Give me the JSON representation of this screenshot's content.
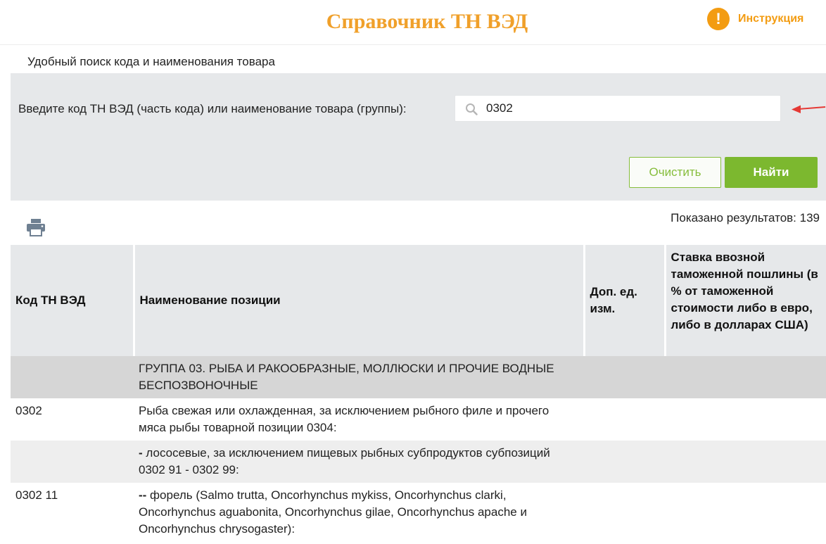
{
  "header": {
    "title": "Справочник ТН ВЭД",
    "help_label": "Инструкция",
    "help_icon_glyph": "!"
  },
  "subtitle": "Удобный поиск кода и наименования товара",
  "search": {
    "label": "Введите код ТН ВЭД (часть кода) или наименование товара (группы):",
    "value": "0302",
    "clear_label": "Очистить",
    "find_label": "Найти"
  },
  "results": {
    "count_text": "Показано результатов: 139"
  },
  "table": {
    "headers": {
      "code": "Код ТН ВЭД",
      "name": "Наименование позиции",
      "unit": "Доп. ед. изм.",
      "rate": "Ставка ввозной таможенной пошлины (в % от таможенной стоимости либо в евро, либо в долларах США)"
    },
    "rows": [
      {
        "code": "",
        "name": "ГРУППА 03. РЫБА И РАКООБРАЗНЫЕ, МОЛЛЮСКИ И ПРОЧИЕ ВОДНЫЕ БЕСПОЗВОНОЧНЫЕ",
        "unit": "",
        "rate": ""
      },
      {
        "code": "0302",
        "name": "Рыба свежая или охлажденная, за исключением рыбного филе и прочего мяса рыбы товарной позиции 0304:",
        "unit": "",
        "rate": ""
      },
      {
        "code": "",
        "dash": "-",
        "name": " лососевые, за исключением пищевых рыбных субпродуктов субпозиций 0302 91 - 0302 99:",
        "unit": "",
        "rate": ""
      },
      {
        "code": "0302 11",
        "dash": "--",
        "name": " форель (Salmo trutta, Oncorhynchus mykiss, Oncorhynchus clarki, Oncorhynchus aguabonita, Oncorhynchus gilae, Oncorhynchus apache и Oncorhynchus chrysogaster):",
        "unit": "",
        "rate": ""
      }
    ]
  },
  "colors": {
    "accent_orange": "#f0a02a",
    "button_green": "#7cb82f",
    "panel_gray": "#e6e8ea",
    "arrow_red": "#e53935"
  },
  "icons": [
    "warning-icon",
    "search-icon",
    "red-arrow-icon",
    "print-icon"
  ]
}
